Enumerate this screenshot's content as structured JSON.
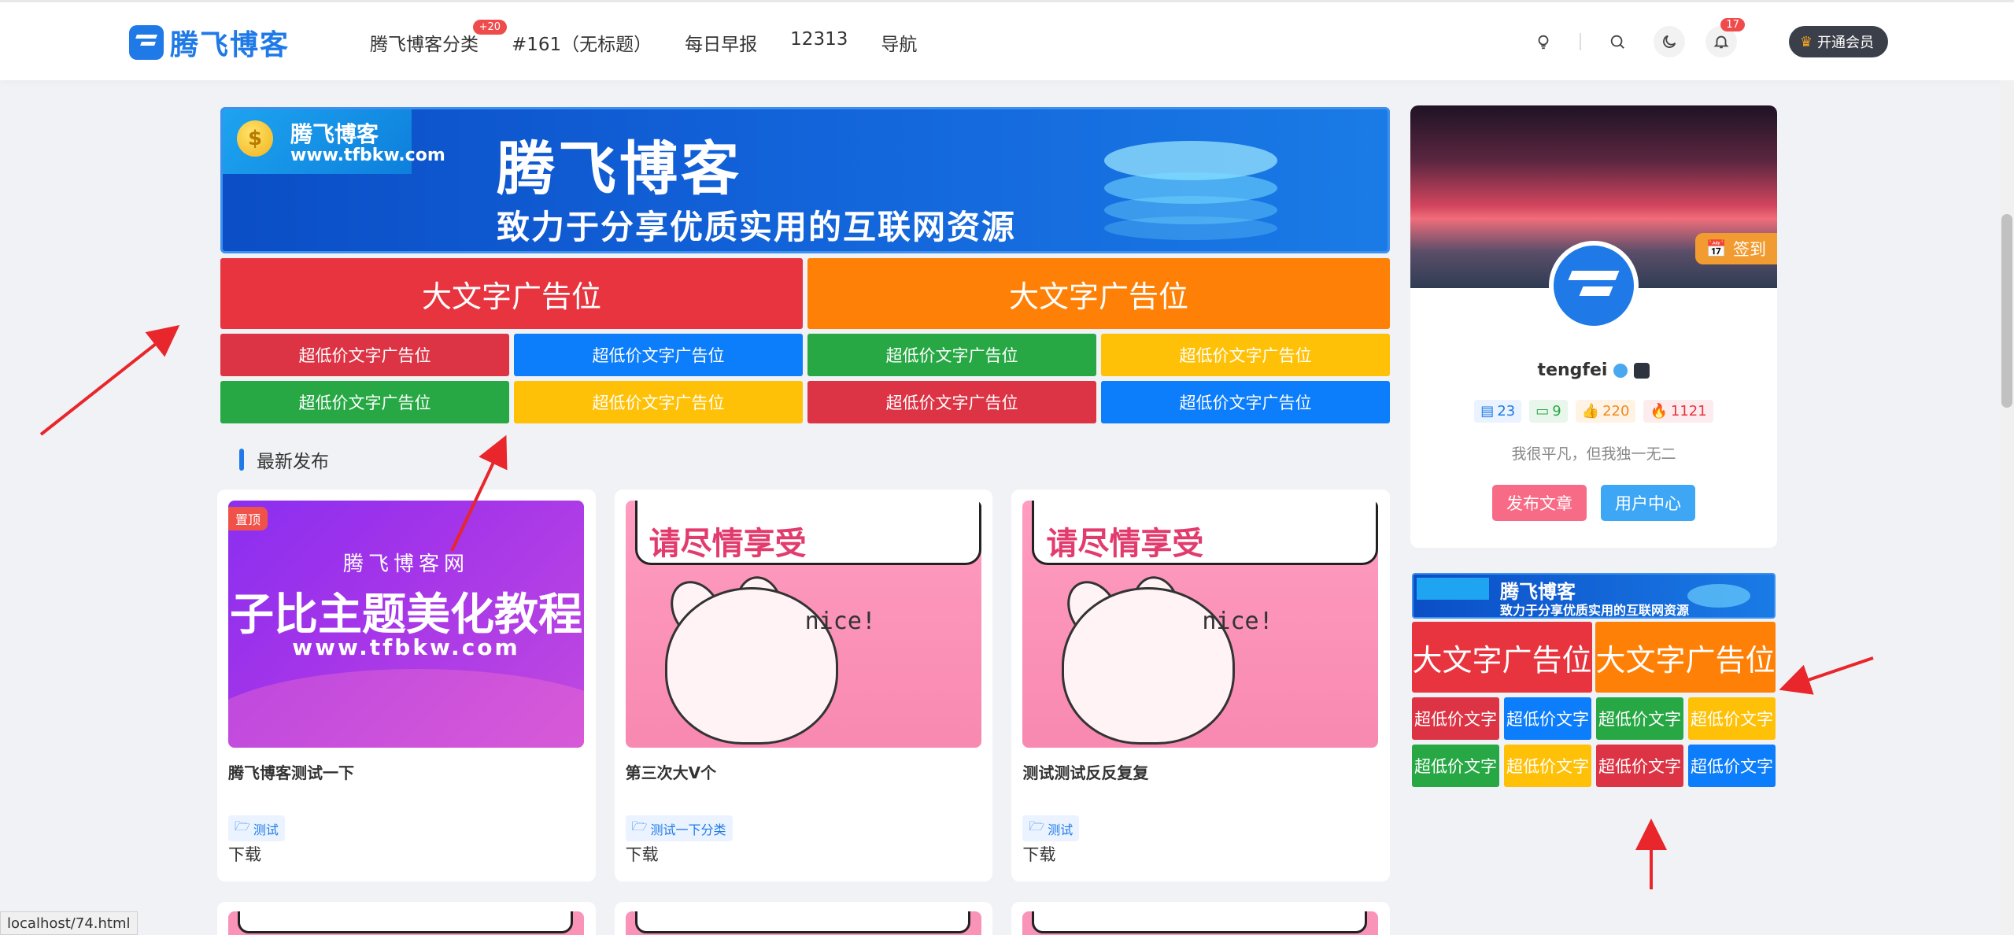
{
  "header": {
    "logo_text": "腾飞博客",
    "nav": [
      {
        "label": "腾飞博客分类",
        "badge": "+20"
      },
      {
        "label": "#161（无标题）"
      },
      {
        "label": "每日早报"
      },
      {
        "label": "12313"
      },
      {
        "label": "导航"
      }
    ],
    "icons": [
      "lightbulb-icon",
      "search-icon",
      "moon-icon",
      "bell-icon"
    ],
    "bell_badge": "17",
    "vip_label": "开通会员"
  },
  "banner": {
    "brand": "腾飞博客",
    "url": "www.tfbkw.com",
    "coin": "$",
    "title": "腾飞博客",
    "subtitle": "致力于分享优质实用的互联网资源"
  },
  "big_ads": [
    {
      "label": "大文字广告位",
      "color": "#e8343f"
    },
    {
      "label": "大文字广告位",
      "color": "#ff8006"
    }
  ],
  "small_ads": [
    {
      "label": "超低价文字广告位",
      "color": "#dd3445"
    },
    {
      "label": "超低价文字广告位",
      "color": "#0c7dfb"
    },
    {
      "label": "超低价文字广告位",
      "color": "#27a844"
    },
    {
      "label": "超低价文字广告位",
      "color": "#ffc107"
    },
    {
      "label": "超低价文字广告位",
      "color": "#27a844"
    },
    {
      "label": "超低价文字广告位",
      "color": "#ffc107"
    },
    {
      "label": "超低价文字广告位",
      "color": "#dd3445"
    },
    {
      "label": "超低价文字广告位",
      "color": "#0c7dfb"
    }
  ],
  "section": {
    "title": "最新发布"
  },
  "cards": [
    {
      "title": "腾飞博客测试一下",
      "tag": "测试",
      "meta": "下载",
      "pin": "置顶",
      "thumb": {
        "line1": "腾飞博客网",
        "line2": "子比主题美化教程",
        "line3": "www.tfbkw.com"
      }
    },
    {
      "title": "第三次大V个",
      "tag": "测试一下分类",
      "meta": "下载",
      "thumb": {
        "bubble": "请尽情享受",
        "nice": "nice!"
      }
    },
    {
      "title": "测试测试反反复复",
      "tag": "测试",
      "meta": "下载",
      "thumb": {
        "bubble": "请尽情享受",
        "nice": "nice!"
      }
    }
  ],
  "profile": {
    "checkin": "签到",
    "username": "tengfei",
    "stats": [
      {
        "value": "23",
        "icon": "doc-icon",
        "color": "#1f7ae8",
        "bg": "#eaf3ff"
      },
      {
        "value": "9",
        "icon": "comment-icon",
        "color": "#27a844",
        "bg": "#e8f6ec"
      },
      {
        "value": "220",
        "icon": "thumbs-up-icon",
        "color": "#f08a1c",
        "bg": "#fff3e6"
      },
      {
        "value": "1121",
        "icon": "fire-icon",
        "color": "#e8343f",
        "bg": "#fdecee"
      }
    ],
    "motto": "我很平凡，但我独一无二",
    "buttons": [
      {
        "label": "发布文章",
        "color": "#f86b86"
      },
      {
        "label": "用户中心",
        "color": "#3ea7f5"
      }
    ]
  },
  "side_ads": {
    "banner_title": "腾飞博客",
    "banner_sub": "致力于分享优质实用的互联网资源",
    "big": [
      {
        "label": "大文字广告位",
        "color": "#e8343f"
      },
      {
        "label": "大文字广告位",
        "color": "#ff8006"
      }
    ],
    "small": [
      {
        "label": "超低价文字",
        "color": "#dd3445"
      },
      {
        "label": "超低价文字",
        "color": "#0c7dfb"
      },
      {
        "label": "超低价文字",
        "color": "#27a844"
      },
      {
        "label": "超低价文字",
        "color": "#ffc107"
      },
      {
        "label": "超低价文字",
        "color": "#27a844"
      },
      {
        "label": "超低价文字",
        "color": "#ffc107"
      },
      {
        "label": "超低价文字",
        "color": "#dd3445"
      },
      {
        "label": "超低价文字",
        "color": "#0c7dfb"
      }
    ]
  },
  "status_bar": {
    "url": "localhost/74.html"
  }
}
